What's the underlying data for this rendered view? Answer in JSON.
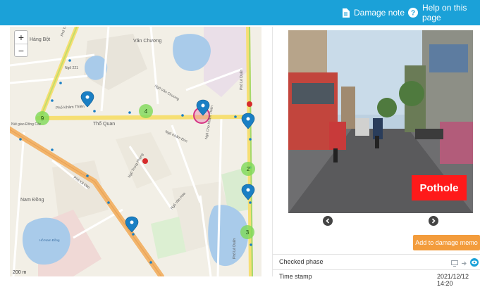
{
  "header": {
    "damage_note_label": "Damage note",
    "help_label": "Help on this page",
    "bar_color": "#1ba1d8",
    "damage_note_icon": "note-icon",
    "help_icon": "question-circle-icon"
  },
  "map": {
    "zoom_in_label": "+",
    "zoom_out_label": "−",
    "scale_label": "200 m",
    "labels": {
      "hang_bot": "Hàng Bột",
      "van_chuong": "Văn Chương",
      "pho_kham_thien": "Phố Khâm Thiên",
      "tho_quan": "Thổ Quan",
      "nam_dong": "Nam Đồng",
      "ngo_221": "Ngõ 221",
      "pho_xa_dan": "Phố Xã Đàn",
      "ngo_van_chuong": "Ngõ Văn Chương",
      "pho_le_duan": "Phố Lê Duẩn",
      "ngo_cho_kham_thien": "Ngõ Chợ Khâm Thiên",
      "ngo_trung_phung": "Ngõ Trung Phụng",
      "ngo_kham_duc": "Ngõ Khâm Đức",
      "pho_ton_duc": "Phố Tôn Đức",
      "ngo_van_hoa": "Ngõ Văn Hóa",
      "nut_giao": "Nút giao Đông Các",
      "ho_nam_dong": "Hồ Nam Đồng",
      "le_duan_side": "Phố Lê Duẩn"
    },
    "clusters": [
      "9",
      "4",
      "2",
      "3"
    ],
    "marker_color": "#1a7fc4",
    "cluster_color": "#7ed957"
  },
  "photo": {
    "damage_label": "Pothole",
    "prev_icon": "chevron-left-circle-icon",
    "next_icon": "chevron-right-circle-icon"
  },
  "details": {
    "add_button_label": "Add to damage memo",
    "checked_phase_label": "Checked phase",
    "time_stamp_label": "Time stamp",
    "time_stamp_value": "2021/12/12 14:20",
    "phase_icons": [
      "monitor-icon",
      "arrow-right-icon",
      "eye-icon"
    ],
    "accent": "#f39c3c"
  }
}
